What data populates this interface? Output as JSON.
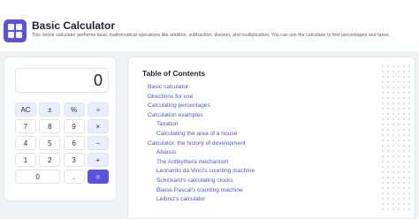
{
  "header": {
    "title": "Basic Calculator",
    "description": "This online calculator performs basic mathematical operations like addition, subtraction, division, and multiplication. You can use the calculator to find percentages and taxes."
  },
  "calculator": {
    "display_value": "0",
    "keys": [
      {
        "label": "AC",
        "name": "key-clear",
        "kind": "op"
      },
      {
        "label": "±",
        "name": "key-plus-minus",
        "kind": "op"
      },
      {
        "label": "%",
        "name": "key-percent",
        "kind": "op"
      },
      {
        "label": "÷",
        "name": "key-divide",
        "kind": "op"
      },
      {
        "label": "7",
        "name": "key-7",
        "kind": "num"
      },
      {
        "label": "8",
        "name": "key-8",
        "kind": "num"
      },
      {
        "label": "9",
        "name": "key-9",
        "kind": "num"
      },
      {
        "label": "×",
        "name": "key-multiply",
        "kind": "op"
      },
      {
        "label": "4",
        "name": "key-4",
        "kind": "num"
      },
      {
        "label": "5",
        "name": "key-5",
        "kind": "num"
      },
      {
        "label": "6",
        "name": "key-6",
        "kind": "num"
      },
      {
        "label": "−",
        "name": "key-subtract",
        "kind": "op"
      },
      {
        "label": "1",
        "name": "key-1",
        "kind": "num"
      },
      {
        "label": "2",
        "name": "key-2",
        "kind": "num"
      },
      {
        "label": "3",
        "name": "key-3",
        "kind": "num"
      },
      {
        "label": "+",
        "name": "key-add",
        "kind": "op"
      },
      {
        "label": "0",
        "name": "key-0",
        "kind": "wide"
      },
      {
        "label": ".",
        "name": "key-decimal",
        "kind": "num"
      },
      {
        "label": "=",
        "name": "key-equals",
        "kind": "eq"
      }
    ]
  },
  "toc": {
    "title": "Table of Contents",
    "items": [
      {
        "label": "Basic calculator",
        "level": 1
      },
      {
        "label": "Directions for use",
        "level": 1
      },
      {
        "label": "Calculating percentages",
        "level": 1
      },
      {
        "label": "Calculation examples",
        "level": 1
      },
      {
        "label": "Taxation",
        "level": 2
      },
      {
        "label": "Calculating the area of a house",
        "level": 2
      },
      {
        "label": "Calculator: the history of development",
        "level": 1
      },
      {
        "label": "Abacus",
        "level": 2
      },
      {
        "label": "The Antikythera mechanism",
        "level": 2
      },
      {
        "label": "Leonardo da Vinci's counting machine",
        "level": 2
      },
      {
        "label": "Schickard's calculating clocks",
        "level": 2
      },
      {
        "label": "Blaise Pascal's counting machine",
        "level": 2
      },
      {
        "label": "Leibniz's calculator",
        "level": 2
      }
    ]
  },
  "colors": {
    "accent": "#5b52e0",
    "link": "#4f55d9",
    "operator_key_bg": "#e9eefc",
    "page_bg": "#f1f2f6"
  },
  "icons": {
    "logo": "calculator-grid-icon"
  }
}
